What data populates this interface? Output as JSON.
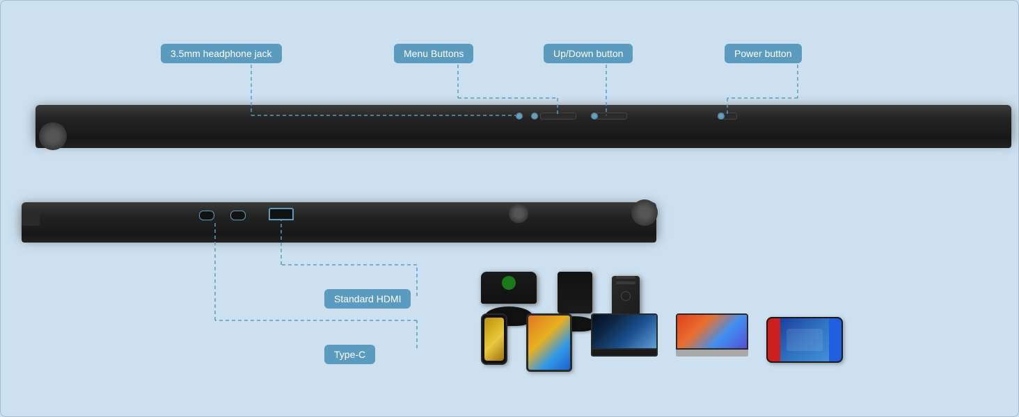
{
  "background": "#cde0ef",
  "labels": {
    "headphone": "3.5mm headphone jack",
    "menu": "Menu Buttons",
    "updown": "Up/Down button",
    "power": "Power button",
    "hdmi": "Standard HDMI",
    "typec": "Type-C"
  },
  "devices": {
    "row1": [
      "Xbox console",
      "PS console",
      "PC tower"
    ],
    "row2": [
      "Android phone",
      "iPad tablet",
      "Gaming laptop",
      "MacBook",
      "Nintendo Switch"
    ]
  }
}
